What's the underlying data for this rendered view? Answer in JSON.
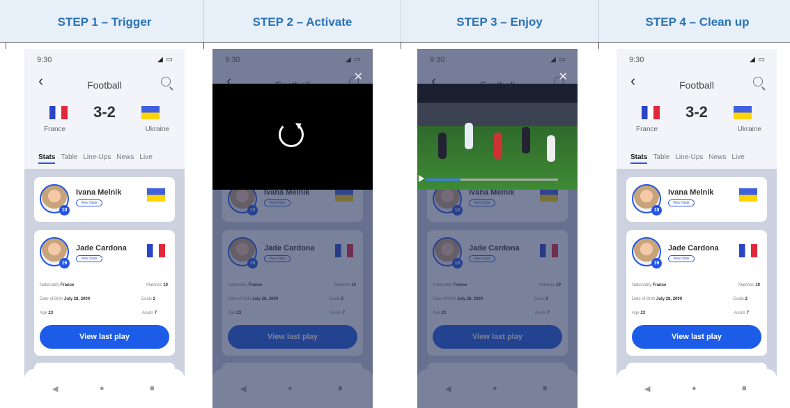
{
  "steps": [
    "STEP 1 – Trigger",
    "STEP 2 – Activate",
    "STEP 3 – Enjoy",
    "STEP 4 – Clean up"
  ],
  "screen": {
    "time": "9:30",
    "title": "Football",
    "back_icon": "chevron-left-icon",
    "search_icon": "search-icon",
    "score": "3-2",
    "team_home": "France",
    "team_away": "Ukraine",
    "tabs": [
      "Stats",
      "Table",
      "Line-Ups",
      "News",
      "Live"
    ],
    "players": [
      {
        "name": "Ivana Melnik",
        "number": "10",
        "stats_label": "View Stats"
      },
      {
        "name": "Jade Cardona",
        "number": "16",
        "stats_label": "View Stats"
      }
    ],
    "details": {
      "nationality_label": "Nationality",
      "nationality": "France",
      "dob_label": "Date of Birth",
      "dob": "July 28, 2000",
      "age_label": "Age",
      "age": "23",
      "matches_label": "Matches",
      "matches": "10",
      "goals_label": "Goals",
      "goals": "2",
      "assists_label": "Assits",
      "assists": "7"
    },
    "button": "View last play"
  },
  "colors": {
    "accent": "#1c5ce8",
    "header": "#e7f0f8",
    "title": "#2a72b6"
  }
}
